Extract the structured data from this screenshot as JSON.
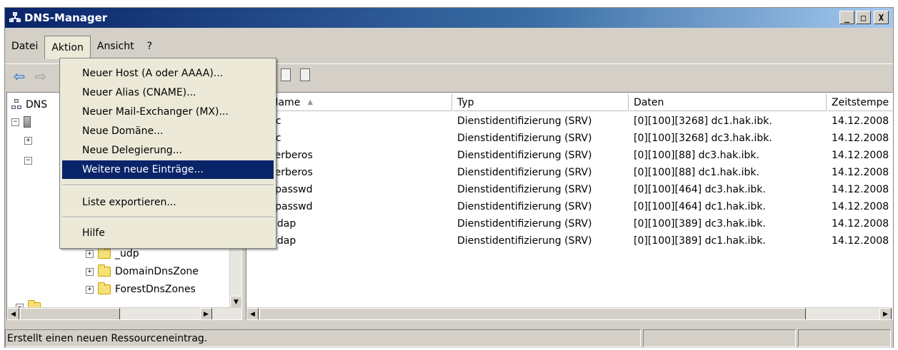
{
  "window": {
    "title": "DNS-Manager",
    "buttons": [
      "_",
      "□",
      "X"
    ]
  },
  "menubar": {
    "items": [
      "Datei",
      "Aktion",
      "Ansicht",
      "?"
    ]
  },
  "aktion_menu": {
    "items": [
      "Neuer Host (A oder AAAA)...",
      "Neuer Alias (CNAME)...",
      "Neuer Mail-Exchanger (MX)...",
      "Neue Domäne...",
      "Neue Delegierung...",
      "Weitere neue Einträge...",
      "Liste exportieren...",
      "Hilfe"
    ],
    "highlighted": "Weitere neue Einträge..."
  },
  "tree": {
    "root_label": "DNS",
    "visible_items": [
      {
        "expander": "+",
        "label": "_udp"
      },
      {
        "expander": "+",
        "label": "DomainDnsZone"
      },
      {
        "expander": "+",
        "label": "ForestDnsZones"
      }
    ]
  },
  "list": {
    "columns": [
      "Name",
      "Typ",
      "Daten",
      "Zeitstempe"
    ],
    "sort_indicator": "▲",
    "rows": [
      {
        "name": "_gc",
        "name_visible": "gc",
        "type": "Dienstidentifizierung (SRV)",
        "data": "[0][100][3268] dc1.hak.ibk.",
        "timestamp": "14.12.2008"
      },
      {
        "name": "_gc",
        "name_visible": "gc",
        "type": "Dienstidentifizierung (SRV)",
        "data": "[0][100][3268] dc3.hak.ibk.",
        "timestamp": "14.12.2008"
      },
      {
        "name": "_kerberos",
        "name_visible": "kerberos",
        "type": "Dienstidentifizierung (SRV)",
        "data": "[0][100][88] dc3.hak.ibk.",
        "timestamp": "14.12.2008"
      },
      {
        "name": "_kerberos",
        "name_visible": "kerberos",
        "type": "Dienstidentifizierung (SRV)",
        "data": "[0][100][88] dc1.hak.ibk.",
        "timestamp": "14.12.2008"
      },
      {
        "name": "_kpasswd",
        "name_visible": "kpasswd",
        "type": "Dienstidentifizierung (SRV)",
        "data": "[0][100][464] dc3.hak.ibk.",
        "timestamp": "14.12.2008"
      },
      {
        "name": "_kpasswd",
        "name_visible": "kpasswd",
        "type": "Dienstidentifizierung (SRV)",
        "data": "[0][100][464] dc1.hak.ibk.",
        "timestamp": "14.12.2008"
      },
      {
        "name": "_ldap",
        "name_visible": "_ldap",
        "type": "Dienstidentifizierung (SRV)",
        "data": "[0][100][389] dc3.hak.ibk.",
        "timestamp": "14.12.2008"
      },
      {
        "name": "_ldap",
        "name_visible": "_ldap",
        "type": "Dienstidentifizierung (SRV)",
        "data": "[0][100][389] dc1.hak.ibk.",
        "timestamp": "14.12.2008"
      }
    ]
  },
  "statusbar": {
    "text": "Erstellt einen neuen Ressourceneintrag."
  }
}
